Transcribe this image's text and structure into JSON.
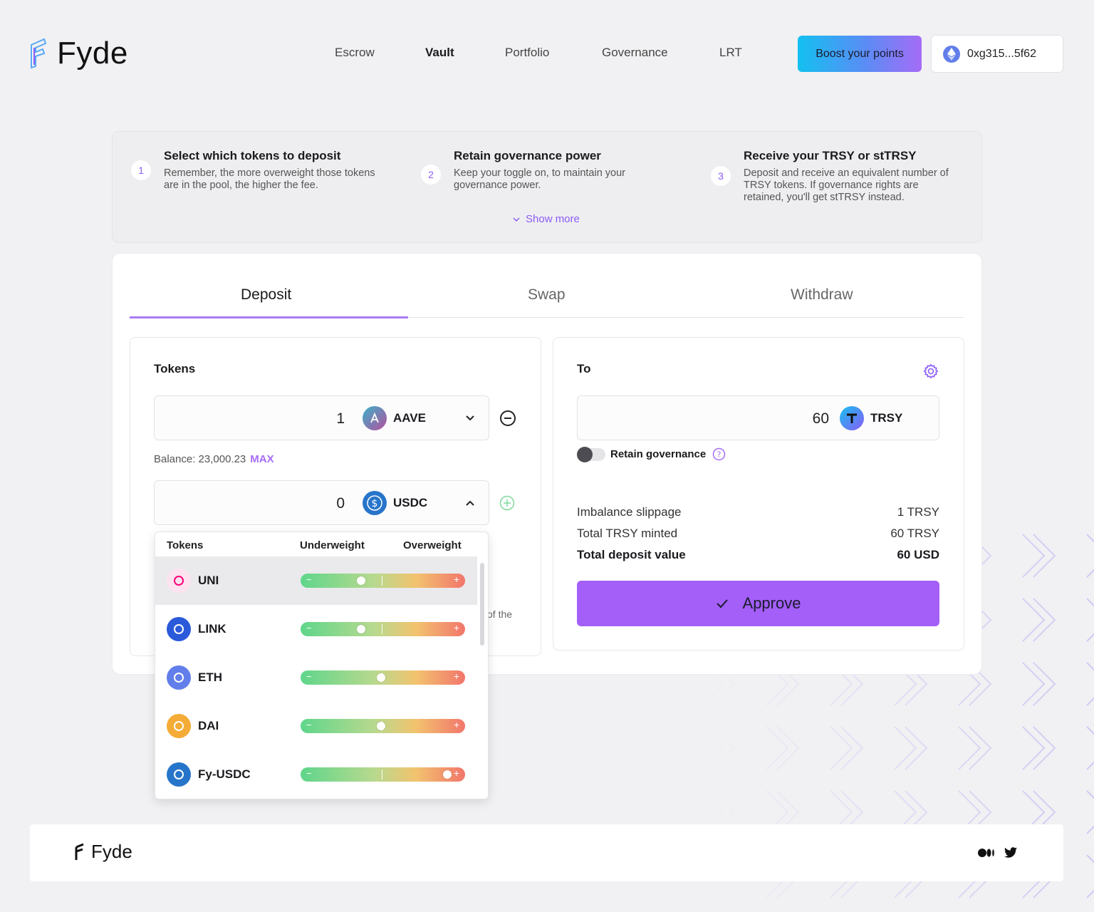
{
  "brand": {
    "name": "Fyde"
  },
  "nav": {
    "items": [
      "Escrow",
      "Vault",
      "Portfolio",
      "Governance",
      "LRT"
    ],
    "active": "Vault"
  },
  "header": {
    "boost_label": "Boost your points",
    "wallet_address": "0xg315...5f62"
  },
  "steps": [
    {
      "num": "1",
      "title": "Select which tokens to deposit",
      "desc": "Remember, the more overweight those tokens are in the pool, the higher the fee."
    },
    {
      "num": "2",
      "title": "Retain governance power",
      "desc": "Keep your toggle on, to maintain your governance power."
    },
    {
      "num": "3",
      "title": "Receive your TRSY or stTRSY",
      "desc": "Deposit and receive an equivalent number of TRSY tokens. If governance rights are retained, you'll get stTRSY instead."
    }
  ],
  "show_more": "Show more",
  "tabs": [
    "Deposit",
    "Swap",
    "Withdraw"
  ],
  "active_tab": "Deposit",
  "deposit": {
    "tokens_label": "Tokens",
    "row1": {
      "amount": "1",
      "token": "AAVE"
    },
    "balance_label": "Balance: 23,000.23",
    "max_label": "MAX",
    "row2": {
      "amount": "0",
      "token": "USDC"
    },
    "hidden_text": "of the"
  },
  "dropdown": {
    "headers": {
      "tokens": "Tokens",
      "under": "Underweight",
      "over": "Overweight"
    },
    "items": [
      {
        "name": "UNI",
        "level": 0.37,
        "color": "#ff007a"
      },
      {
        "name": "LINK",
        "level": 0.37,
        "color": "#2a5ada"
      },
      {
        "name": "ETH",
        "level": 0.49,
        "color": "#627eea"
      },
      {
        "name": "DAI",
        "level": 0.49,
        "color": "#f5ac37"
      },
      {
        "name": "Fy-USDC",
        "level": 0.89,
        "color": "#2775ca"
      }
    ]
  },
  "to": {
    "label": "To",
    "amount": "60",
    "token": "TRSY",
    "retain_label": "Retain governance",
    "summary": [
      {
        "label": "Imbalance slippage",
        "value": "1 TRSY"
      },
      {
        "label": "Total TRSY minted",
        "value": "60 TRSY"
      },
      {
        "label": "Total deposit value",
        "value": "60 USD"
      }
    ],
    "approve_label": "Approve"
  },
  "colors": {
    "accent": "#a35ff7",
    "purple_text": "#8b5cf6"
  }
}
